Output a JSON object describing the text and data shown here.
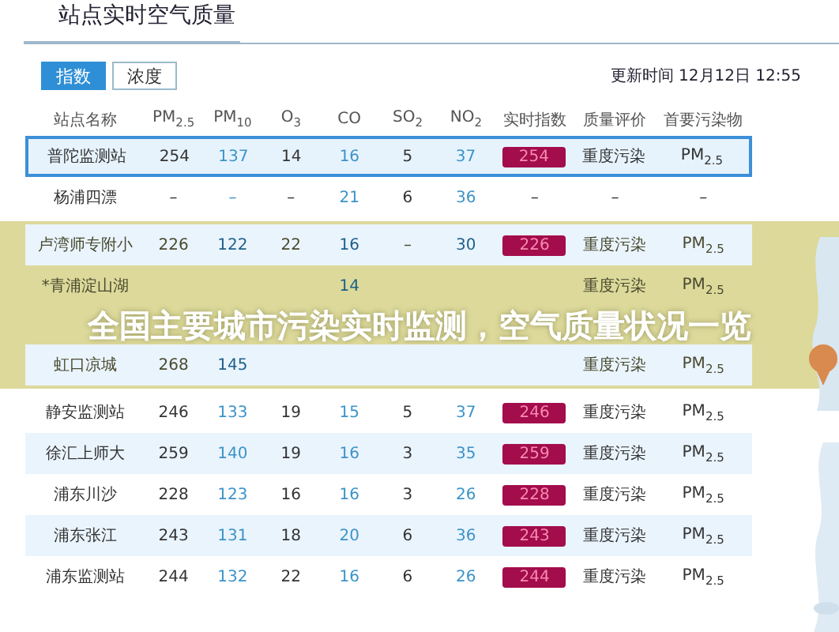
{
  "section_title": "站点实时空气质量",
  "tabs": [
    {
      "label": "指数",
      "selected": true
    },
    {
      "label": "浓度",
      "selected": false
    }
  ],
  "update_time": "更新时间 12月12日 12:55",
  "table": {
    "columns": [
      {
        "label": "站点名称",
        "kind": "plain"
      },
      {
        "label": "PM$_{2.5}$",
        "kind": "plain"
      },
      {
        "label": "PM$_{10}$",
        "kind": "link"
      },
      {
        "label": "O$_{3}$",
        "kind": "plain"
      },
      {
        "label": "CO",
        "kind": "link"
      },
      {
        "label": "SO$_{2}$",
        "kind": "plain"
      },
      {
        "label": "NO$_{2}$",
        "kind": "link"
      },
      {
        "label": "实时指数",
        "kind": "badge"
      },
      {
        "label": "质量评价",
        "kind": "plain"
      },
      {
        "label": "首要污染物",
        "kind": "plain"
      }
    ],
    "rows": [
      {
        "selected": true,
        "cells": [
          "普陀监测站",
          "254",
          "137",
          "14",
          "16",
          "5",
          "37"
        ],
        "index": "254",
        "color": "#a30d4c",
        "quality": "重度污染",
        "pollutant": "PM$_{2.5}$"
      },
      {
        "selected": false,
        "cells": [
          "杨浦四漂",
          "–",
          "–",
          "–",
          "21",
          "6",
          "36"
        ],
        "index": "–",
        "quality": "–",
        "pollutant": "–"
      },
      {
        "selected": false,
        "cells": [
          "卢湾师专附小",
          "226",
          "122",
          "22",
          "16",
          "–",
          "30"
        ],
        "index": "226",
        "color": "#a30d4c",
        "quality": "重度污染",
        "pollutant": "PM$_{2.5}$"
      },
      {
        "selected": false,
        "cells": [
          "*青浦淀山湖",
          "",
          "",
          "",
          "14",
          "",
          ""
        ],
        "quality": "重度污染",
        "pollutant": "PM$_{2.5}$"
      },
      {
        "selected": false,
        "cells": [
          "虹口凉城",
          "268",
          "145",
          "",
          "",
          "",
          ""
        ],
        "quality": "重度污染",
        "pollutant": "PM$_{2.5}$"
      },
      {
        "selected": false,
        "cells": [
          "静安监测站",
          "246",
          "133",
          "19",
          "15",
          "5",
          "37"
        ],
        "index": "246",
        "color": "#a30d4c",
        "quality": "重度污染",
        "pollutant": "PM$_{2.5}$"
      },
      {
        "selected": false,
        "cells": [
          "徐汇上师大",
          "259",
          "140",
          "19",
          "16",
          "3",
          "35"
        ],
        "index": "259",
        "color": "#a30d4c",
        "quality": "重度污染",
        "pollutant": "PM$_{2.5}$"
      },
      {
        "selected": false,
        "cells": [
          "浦东川沙",
          "228",
          "123",
          "16",
          "16",
          "3",
          "26"
        ],
        "index": "228",
        "color": "#a30d4c",
        "quality": "重度污染",
        "pollutant": "PM$_{2.5}$"
      },
      {
        "selected": false,
        "cells": [
          "浦东张江",
          "243",
          "131",
          "18",
          "20",
          "6",
          "36"
        ],
        "index": "243",
        "color": "#a30d4c",
        "quality": "重度污染",
        "pollutant": "PM$_{2.5}$"
      },
      {
        "selected": false,
        "cells": [
          "浦东监测站",
          "244",
          "132",
          "22",
          "16",
          "6",
          "26"
        ],
        "index": "244",
        "color": "#a30d4c",
        "quality": "重度污染",
        "pollutant": "PM$_{2.5}$"
      }
    ]
  },
  "banner": {
    "title": "全国主要城市污染实时监测，空气质量状况一览"
  }
}
